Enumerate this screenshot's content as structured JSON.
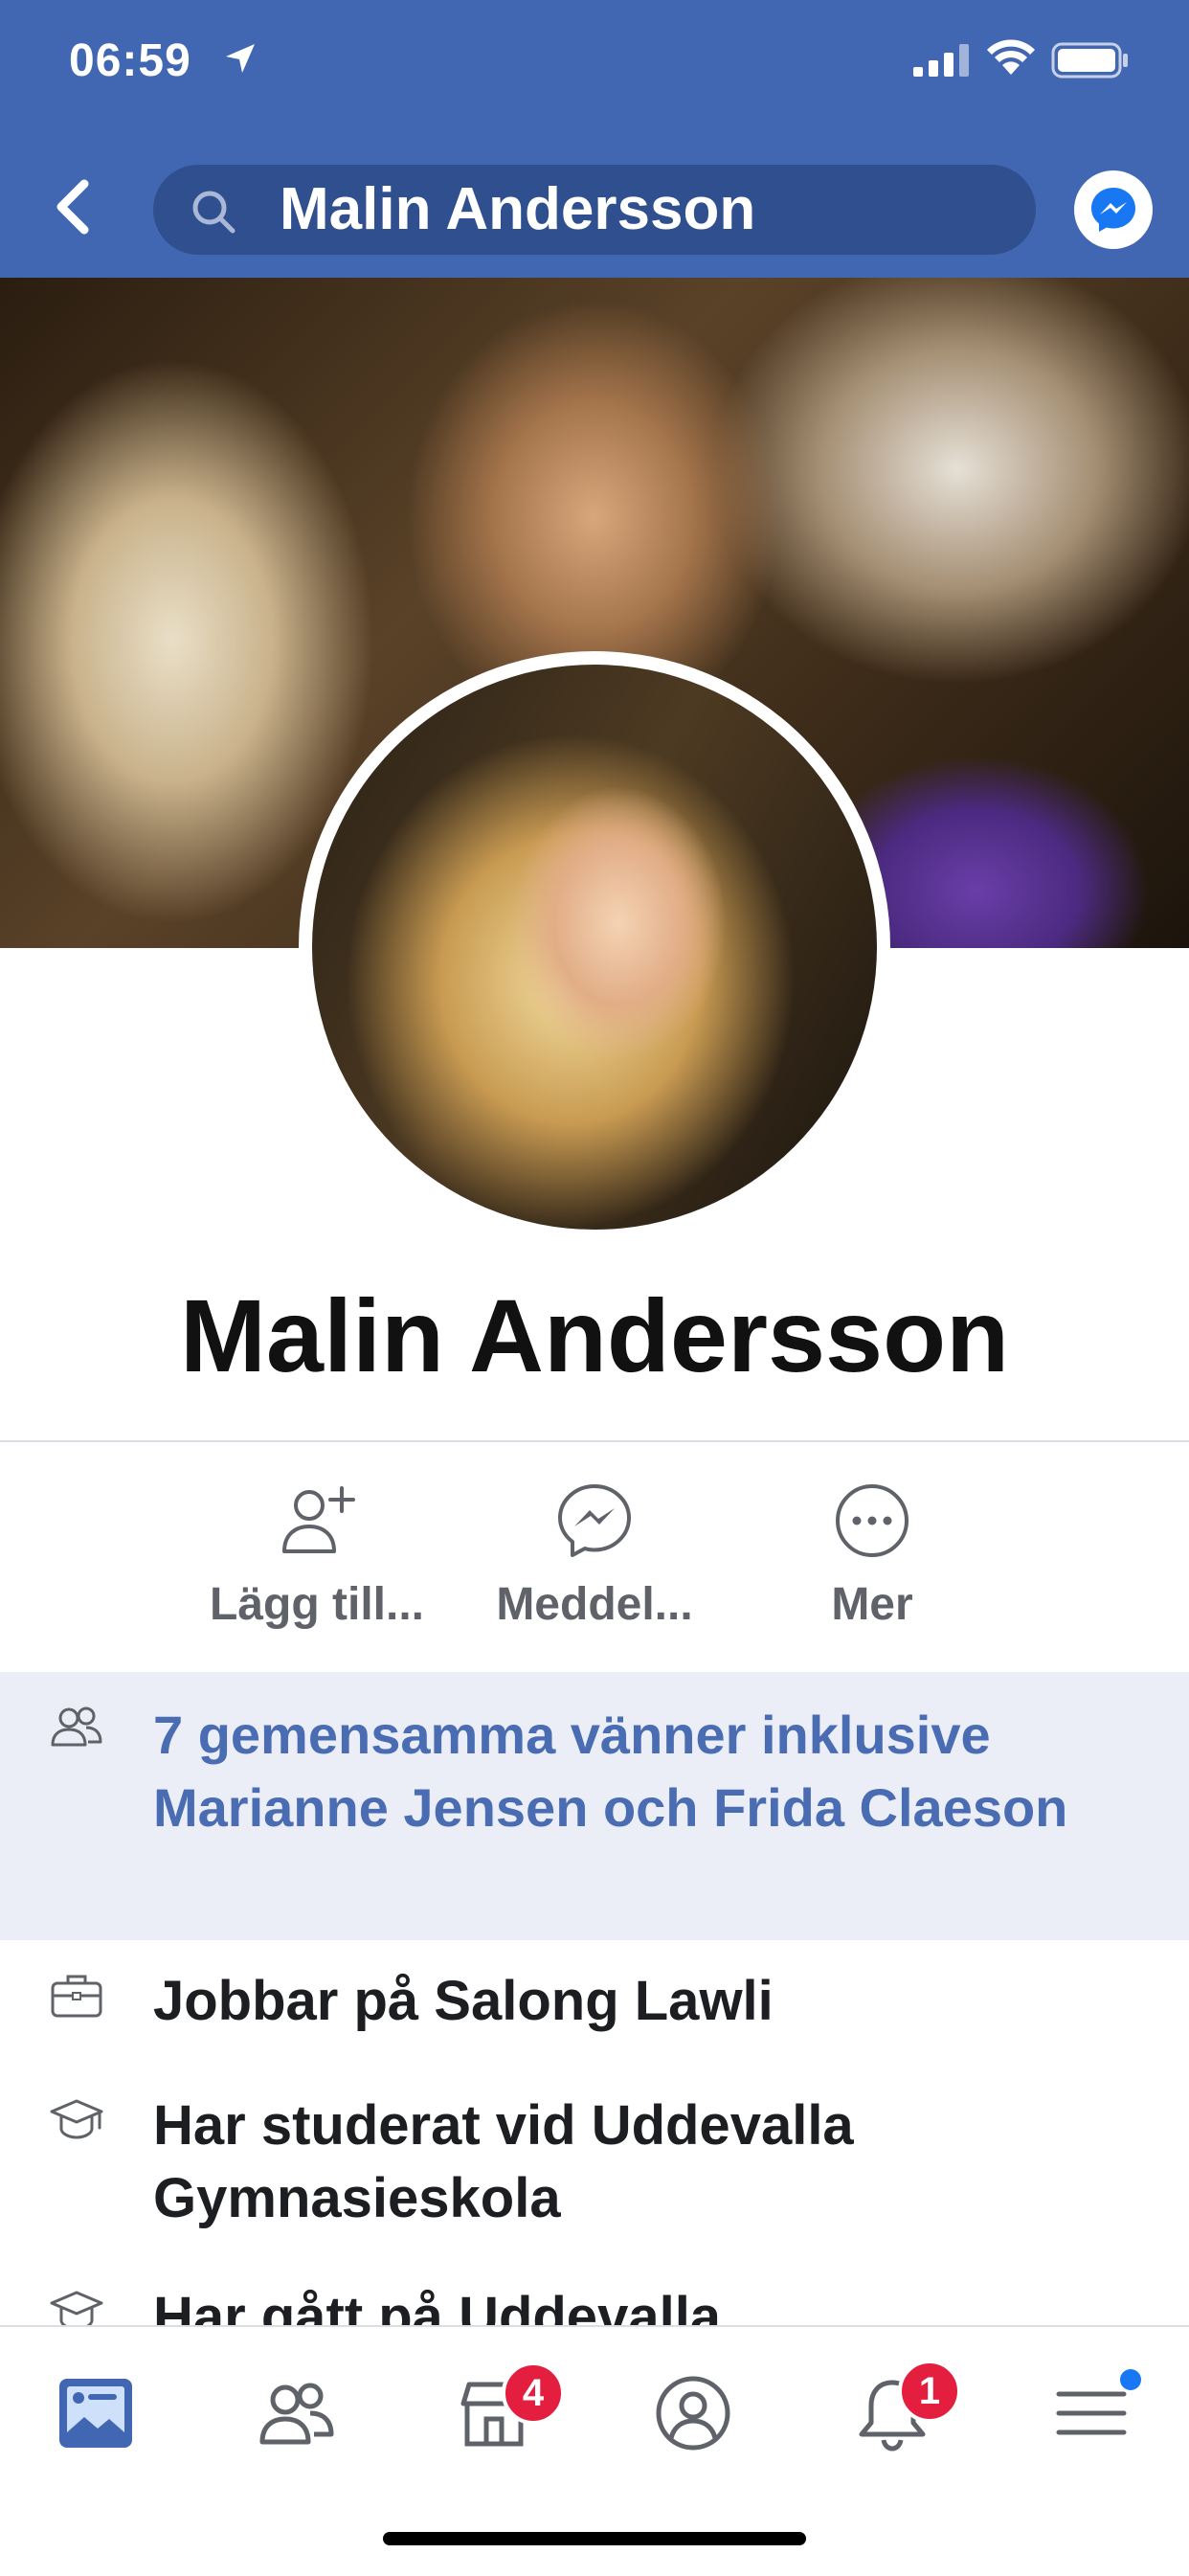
{
  "status_bar": {
    "time": "06:59"
  },
  "header": {
    "search_text": "Malin Andersson"
  },
  "profile": {
    "name": "Malin Andersson"
  },
  "actions": [
    {
      "label": "Lägg till..."
    },
    {
      "label": "Meddel..."
    },
    {
      "label": "Mer"
    }
  ],
  "mutual_friends": {
    "text": "7 gemensamma vänner inklusive Marianne Jensen och Frida Claeson"
  },
  "info": {
    "work": {
      "prefix": "Jobbar på ",
      "place": "Salong Lawli"
    },
    "studied": {
      "prefix": "Har studerat vid ",
      "place": "Uddevalla Gymnasieskola"
    },
    "went": {
      "prefix": "Har gått på ",
      "place": "Uddevalla"
    }
  },
  "tabbar": {
    "marketplace_badge": "4",
    "notifications_badge": "1"
  },
  "colors": {
    "brand": "#4267b2",
    "mutual_bg": "#ebeef6",
    "mutual_text": "#4a6cb2",
    "badge": "#e41e3f",
    "menu_dot": "#1877f2"
  },
  "icons": [
    "location-arrow-icon",
    "signal-icon",
    "wifi-icon",
    "battery-icon",
    "back-chevron-icon",
    "search-icon",
    "messenger-icon",
    "add-friend-icon",
    "message-icon",
    "more-icon",
    "friends-icon",
    "briefcase-icon",
    "graduation-cap-icon",
    "news-feed-icon",
    "friends-tab-icon",
    "marketplace-icon",
    "profile-tab-icon",
    "bell-icon",
    "menu-icon"
  ]
}
